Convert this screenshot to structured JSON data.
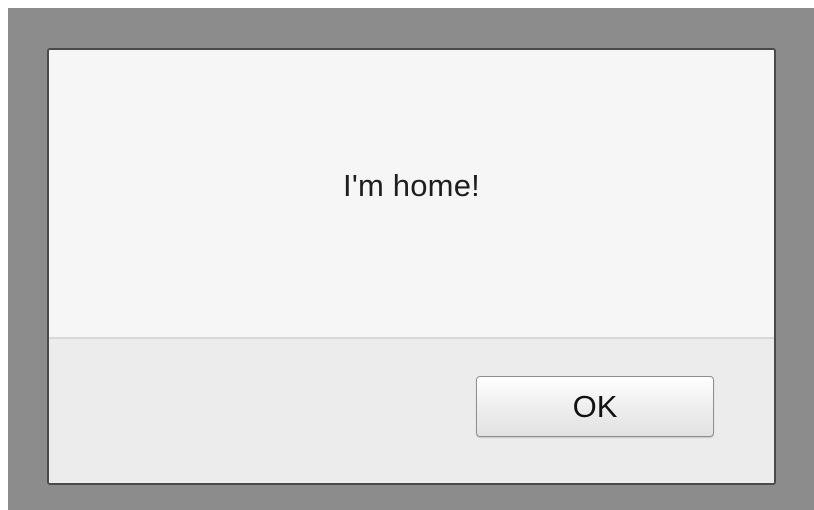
{
  "dialog": {
    "message": "I'm home!",
    "ok_label": "OK"
  }
}
